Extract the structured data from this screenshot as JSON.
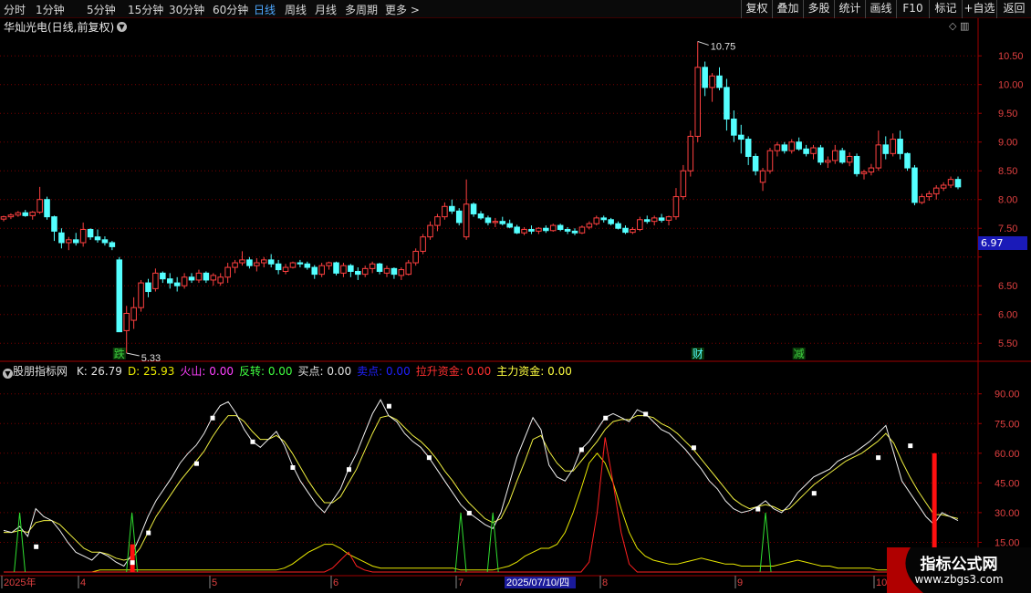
{
  "toolbar": {
    "periods": [
      "分时",
      "1分钟",
      "5分钟",
      "15分钟",
      "30分钟",
      "60分钟",
      "日线",
      "周线",
      "月线",
      "多周期",
      "更多 >"
    ],
    "active_period": "日线",
    "buttons": [
      "复权",
      "叠加",
      "多股",
      "统计",
      "画线",
      "F10",
      "标记",
      "+自选",
      "返回"
    ]
  },
  "main_panel": {
    "title": "华灿光电(日线,前复权)",
    "y_ticks": [
      "10.50",
      "10.00",
      "9.50",
      "9.00",
      "8.50",
      "8.00",
      "7.50",
      "6.97",
      "6.50",
      "6.00",
      "5.50"
    ],
    "current_price": "6.97",
    "high_marker": "10.75",
    "low_marker": "5.33",
    "signals": [
      "跌",
      "财",
      "减"
    ]
  },
  "indicator_panel": {
    "name": "股朋指标网",
    "values": [
      {
        "label": "K: ",
        "value": "26.79",
        "color": "#e0e0e0"
      },
      {
        "label": "D: ",
        "value": "25.93",
        "color": "#e8e800"
      },
      {
        "label": "火山: ",
        "value": "0.00",
        "color": "#ff40ff"
      },
      {
        "label": "反转: ",
        "value": "0.00",
        "color": "#40ff40"
      },
      {
        "label": "买点: ",
        "value": "0.00",
        "color": "#e0e0e0"
      },
      {
        "label": "卖点: ",
        "value": "0.00",
        "color": "#2020ff"
      },
      {
        "label": "拉升资金: ",
        "value": "0.00",
        "color": "#ff3030"
      },
      {
        "label": "主力资金: ",
        "value": "0.00",
        "color": "#ffff40"
      }
    ],
    "y_ticks": [
      "90.00",
      "75.00",
      "60.00",
      "45.00",
      "30.00",
      "15.00"
    ]
  },
  "date_axis": {
    "labels": [
      "2025年",
      "4",
      "5",
      "6",
      "7",
      "8",
      "9",
      "10"
    ],
    "cursor_date": "2025/07/10/四"
  },
  "watermark": {
    "title": "指标公式网",
    "url": "www.zbgs3.com"
  },
  "colors": {
    "up": "#ff4040",
    "down": "#54ffff",
    "grid": "#7a0000",
    "axis": "#a00000"
  },
  "chart_data": {
    "type": "candlestick",
    "y_range": [
      5.25,
      10.9
    ],
    "candles": [
      [
        7.66,
        7.72,
        7.62,
        7.7
      ],
      [
        7.7,
        7.76,
        7.66,
        7.73
      ],
      [
        7.73,
        7.8,
        7.7,
        7.77
      ],
      [
        7.77,
        7.82,
        7.7,
        7.72
      ],
      [
        7.72,
        7.8,
        7.65,
        7.78
      ],
      [
        7.78,
        8.22,
        7.75,
        8.0
      ],
      [
        8.0,
        8.05,
        7.65,
        7.7
      ],
      [
        7.7,
        7.72,
        7.28,
        7.45
      ],
      [
        7.42,
        7.5,
        7.15,
        7.25
      ],
      [
        7.25,
        7.35,
        7.12,
        7.3
      ],
      [
        7.3,
        7.42,
        7.2,
        7.25
      ],
      [
        7.25,
        7.6,
        7.18,
        7.48
      ],
      [
        7.48,
        7.5,
        7.3,
        7.35
      ],
      [
        7.35,
        7.48,
        7.25,
        7.3
      ],
      [
        7.3,
        7.36,
        7.2,
        7.25
      ],
      [
        7.25,
        7.28,
        7.12,
        7.18
      ],
      [
        6.95,
        7.0,
        5.85,
        5.7
      ],
      [
        5.72,
        6.15,
        5.33,
        6.02
      ],
      [
        5.9,
        6.3,
        5.75,
        6.12
      ],
      [
        6.12,
        6.6,
        6.05,
        6.55
      ],
      [
        6.55,
        6.62,
        6.3,
        6.4
      ],
      [
        6.45,
        6.8,
        6.4,
        6.72
      ],
      [
        6.72,
        6.75,
        6.55,
        6.62
      ],
      [
        6.62,
        6.72,
        6.45,
        6.55
      ],
      [
        6.55,
        6.65,
        6.4,
        6.5
      ],
      [
        6.5,
        6.72,
        6.45,
        6.65
      ],
      [
        6.65,
        6.72,
        6.55,
        6.6
      ],
      [
        6.6,
        6.78,
        6.55,
        6.72
      ],
      [
        6.72,
        6.75,
        6.55,
        6.6
      ],
      [
        6.6,
        6.72,
        6.5,
        6.68
      ],
      [
        6.55,
        6.72,
        6.5,
        6.65
      ],
      [
        6.65,
        6.9,
        6.55,
        6.82
      ],
      [
        6.82,
        6.95,
        6.72,
        6.9
      ],
      [
        6.9,
        7.1,
        6.85,
        6.95
      ],
      [
        6.95,
        7.0,
        6.8,
        6.85
      ],
      [
        6.85,
        6.98,
        6.75,
        6.9
      ],
      [
        6.9,
        7.0,
        6.82,
        6.95
      ],
      [
        6.95,
        7.05,
        6.82,
        6.88
      ],
      [
        6.88,
        6.95,
        6.7,
        6.78
      ],
      [
        6.75,
        6.88,
        6.7,
        6.82
      ],
      [
        6.82,
        6.92,
        6.8,
        6.9
      ],
      [
        6.9,
        6.95,
        6.82,
        6.88
      ],
      [
        6.88,
        6.92,
        6.78,
        6.82
      ],
      [
        6.82,
        6.86,
        6.62,
        6.7
      ],
      [
        6.7,
        6.9,
        6.65,
        6.85
      ],
      [
        6.85,
        6.92,
        6.78,
        6.9
      ],
      [
        6.9,
        6.92,
        6.68,
        6.72
      ],
      [
        6.72,
        6.9,
        6.65,
        6.85
      ],
      [
        6.85,
        6.88,
        6.65,
        6.75
      ],
      [
        6.75,
        6.82,
        6.6,
        6.7
      ],
      [
        6.7,
        6.85,
        6.65,
        6.8
      ],
      [
        6.8,
        6.92,
        6.72,
        6.88
      ],
      [
        6.88,
        6.9,
        6.7,
        6.75
      ],
      [
        6.72,
        6.85,
        6.65,
        6.8
      ],
      [
        6.8,
        6.82,
        6.62,
        6.7
      ],
      [
        6.68,
        6.82,
        6.6,
        6.78
      ],
      [
        6.7,
        6.95,
        6.68,
        6.9
      ],
      [
        6.9,
        7.15,
        6.85,
        7.1
      ],
      [
        7.1,
        7.4,
        7.05,
        7.35
      ],
      [
        7.35,
        7.62,
        7.3,
        7.55
      ],
      [
        7.55,
        7.75,
        7.45,
        7.7
      ],
      [
        7.7,
        7.95,
        7.65,
        7.88
      ],
      [
        7.88,
        8.0,
        7.75,
        7.8
      ],
      [
        7.8,
        7.85,
        7.55,
        7.6
      ],
      [
        7.35,
        8.35,
        7.3,
        7.92
      ],
      [
        7.92,
        7.95,
        7.7,
        7.75
      ],
      [
        7.75,
        7.8,
        7.65,
        7.68
      ],
      [
        7.68,
        7.72,
        7.55,
        7.6
      ],
      [
        7.6,
        7.68,
        7.52,
        7.62
      ],
      [
        7.62,
        7.7,
        7.55,
        7.58
      ],
      [
        7.58,
        7.65,
        7.5,
        7.52
      ],
      [
        7.52,
        7.56,
        7.4,
        7.42
      ],
      [
        7.42,
        7.52,
        7.38,
        7.48
      ],
      [
        7.48,
        7.55,
        7.4,
        7.45
      ],
      [
        7.45,
        7.52,
        7.4,
        7.5
      ],
      [
        7.5,
        7.55,
        7.42,
        7.46
      ],
      [
        7.46,
        7.58,
        7.44,
        7.55
      ],
      [
        7.55,
        7.58,
        7.45,
        7.48
      ],
      [
        7.48,
        7.52,
        7.4,
        7.45
      ],
      [
        7.45,
        7.5,
        7.38,
        7.42
      ],
      [
        7.42,
        7.55,
        7.4,
        7.52
      ],
      [
        7.52,
        7.62,
        7.48,
        7.58
      ],
      [
        7.58,
        7.72,
        7.55,
        7.68
      ],
      [
        7.68,
        7.72,
        7.6,
        7.65
      ],
      [
        7.65,
        7.68,
        7.55,
        7.58
      ],
      [
        7.58,
        7.62,
        7.48,
        7.5
      ],
      [
        7.5,
        7.55,
        7.4,
        7.43
      ],
      [
        7.43,
        7.52,
        7.4,
        7.48
      ],
      [
        7.48,
        7.7,
        7.45,
        7.65
      ],
      [
        7.65,
        7.72,
        7.58,
        7.62
      ],
      [
        7.62,
        7.72,
        7.55,
        7.68
      ],
      [
        7.68,
        7.75,
        7.6,
        7.64
      ],
      [
        7.64,
        7.72,
        7.55,
        7.7
      ],
      [
        7.7,
        8.2,
        7.65,
        8.05
      ],
      [
        8.05,
        8.6,
        8.0,
        8.5
      ],
      [
        8.5,
        9.2,
        8.4,
        9.1
      ],
      [
        9.1,
        10.75,
        9.0,
        10.3
      ],
      [
        10.3,
        10.4,
        9.8,
        9.95
      ],
      [
        9.95,
        10.2,
        9.7,
        10.15
      ],
      [
        10.15,
        10.3,
        9.9,
        9.95
      ],
      [
        9.95,
        10.1,
        9.2,
        9.4
      ],
      [
        9.4,
        9.55,
        9.0,
        9.12
      ],
      [
        9.12,
        9.3,
        8.8,
        9.05
      ],
      [
        9.05,
        9.1,
        8.6,
        8.75
      ],
      [
        8.75,
        8.8,
        8.42,
        8.5
      ],
      [
        8.3,
        8.55,
        8.15,
        8.5
      ],
      [
        8.5,
        8.9,
        8.45,
        8.85
      ],
      [
        8.85,
        9.0,
        8.75,
        8.95
      ],
      [
        8.95,
        9.0,
        8.8,
        8.85
      ],
      [
        8.85,
        9.05,
        8.8,
        9.0
      ],
      [
        9.0,
        9.08,
        8.85,
        8.88
      ],
      [
        8.88,
        8.95,
        8.75,
        8.8
      ],
      [
        8.8,
        8.95,
        8.7,
        8.9
      ],
      [
        8.9,
        8.95,
        8.6,
        8.65
      ],
      [
        8.65,
        8.75,
        8.55,
        8.68
      ],
      [
        8.68,
        8.95,
        8.62,
        8.85
      ],
      [
        8.85,
        8.9,
        8.62,
        8.65
      ],
      [
        8.65,
        8.82,
        8.58,
        8.75
      ],
      [
        8.75,
        8.8,
        8.4,
        8.45
      ],
      [
        8.45,
        8.52,
        8.35,
        8.48
      ],
      [
        8.48,
        8.62,
        8.42,
        8.55
      ],
      [
        8.55,
        9.2,
        8.5,
        8.95
      ],
      [
        8.95,
        9.1,
        8.7,
        8.8
      ],
      [
        8.8,
        9.15,
        8.75,
        9.05
      ],
      [
        9.05,
        9.2,
        8.7,
        8.8
      ],
      [
        8.8,
        8.82,
        8.5,
        8.55
      ],
      [
        8.55,
        8.6,
        7.9,
        7.95
      ],
      [
        7.95,
        8.1,
        7.92,
        8.05
      ],
      [
        8.05,
        8.15,
        7.98,
        8.1
      ],
      [
        8.1,
        8.25,
        8.0,
        8.2
      ],
      [
        8.2,
        8.3,
        8.15,
        8.25
      ],
      [
        8.25,
        8.4,
        8.2,
        8.35
      ],
      [
        8.35,
        8.4,
        8.18,
        8.22
      ]
    ],
    "indicator": {
      "y_range": [
        0,
        100
      ],
      "K": [
        21,
        20,
        23,
        18,
        32,
        28,
        26,
        21,
        15,
        10,
        8,
        6,
        10,
        8,
        5,
        3,
        9,
        18,
        28,
        36,
        42,
        48,
        55,
        60,
        64,
        70,
        78,
        84,
        86,
        80,
        72,
        66,
        63,
        67,
        71,
        64,
        54,
        46,
        40,
        34,
        30,
        36,
        42,
        52,
        60,
        70,
        80,
        87,
        79,
        76,
        70,
        66,
        63,
        58,
        52,
        46,
        40,
        34,
        30,
        27,
        24,
        22,
        30,
        44,
        58,
        68,
        78,
        72,
        54,
        48,
        46,
        52,
        62,
        66,
        72,
        78,
        80,
        78,
        76,
        82,
        80,
        76,
        72,
        70,
        66,
        62,
        57,
        52,
        46,
        42,
        36,
        32,
        30,
        31,
        33,
        36,
        32,
        30,
        34,
        40,
        44,
        48,
        50,
        52,
        56,
        58,
        60,
        63,
        66,
        70,
        74,
        60,
        46,
        40,
        34,
        28,
        24,
        30,
        28,
        26
      ],
      "D": [
        20,
        20,
        21,
        20,
        25,
        26,
        26,
        24,
        20,
        16,
        12,
        10,
        10,
        9,
        7,
        6,
        7,
        12,
        20,
        28,
        34,
        40,
        46,
        51,
        56,
        61,
        68,
        74,
        79,
        79,
        76,
        71,
        67,
        67,
        69,
        66,
        60,
        53,
        46,
        40,
        35,
        35,
        38,
        45,
        52,
        61,
        70,
        78,
        79,
        77,
        73,
        69,
        66,
        62,
        57,
        51,
        46,
        40,
        35,
        31,
        27,
        25,
        27,
        35,
        46,
        56,
        67,
        69,
        61,
        55,
        51,
        51,
        56,
        61,
        66,
        72,
        76,
        77,
        77,
        79,
        79,
        78,
        75,
        73,
        70,
        66,
        62,
        57,
        52,
        47,
        42,
        37,
        34,
        32,
        33,
        34,
        33,
        31,
        32,
        36,
        40,
        44,
        47,
        50,
        53,
        56,
        58,
        60,
        63,
        66,
        70,
        65,
        56,
        48,
        41,
        35,
        29,
        29,
        28,
        27
      ],
      "trend": [
        0,
        0,
        0,
        0,
        0,
        0,
        0,
        0,
        0,
        0,
        0,
        0,
        1,
        1,
        1,
        1,
        1,
        1,
        1,
        1,
        1,
        1,
        1,
        1,
        1,
        1,
        1,
        1,
        1,
        1,
        1,
        1,
        1,
        1,
        1,
        2,
        4,
        7,
        10,
        12,
        14,
        14,
        12,
        9,
        7,
        5,
        3,
        2,
        2,
        2,
        2,
        2,
        2,
        2,
        2,
        2,
        2,
        1,
        1,
        1,
        1,
        1,
        2,
        3,
        5,
        8,
        10,
        12,
        12,
        14,
        20,
        30,
        42,
        55,
        60,
        55,
        45,
        32,
        20,
        12,
        8,
        6,
        5,
        4,
        4,
        5,
        6,
        7,
        6,
        5,
        4,
        4,
        3,
        3,
        3,
        3,
        3,
        4,
        5,
        6,
        5,
        4,
        3,
        3,
        2,
        2,
        2,
        2,
        2,
        1,
        1,
        1,
        2,
        4,
        6,
        7,
        6,
        5,
        4,
        3
      ],
      "pull": [
        0,
        0,
        0,
        0,
        0,
        0,
        0,
        0,
        0,
        0,
        0,
        0,
        0,
        0,
        0,
        0,
        0,
        0,
        0,
        0,
        0,
        0,
        0,
        0,
        0,
        0,
        0,
        0,
        0,
        0,
        0,
        0,
        0,
        0,
        0,
        0,
        0,
        0,
        0,
        0,
        0,
        2,
        6,
        10,
        3,
        1,
        0,
        0,
        0,
        0,
        0,
        0,
        0,
        0,
        0,
        0,
        0,
        0,
        0,
        0,
        0,
        0,
        0,
        0,
        0,
        0,
        0,
        0,
        0,
        0,
        0,
        0,
        0,
        5,
        30,
        68,
        45,
        20,
        4,
        0,
        0,
        0,
        0,
        0,
        0,
        0,
        0,
        0,
        0,
        0,
        0,
        0,
        0,
        0,
        0,
        0,
        0,
        0,
        0,
        0,
        0,
        0,
        0,
        0,
        0,
        0,
        0,
        0,
        0,
        0,
        0,
        0,
        0,
        0,
        0,
        0,
        0,
        0,
        0,
        0
      ]
    }
  }
}
